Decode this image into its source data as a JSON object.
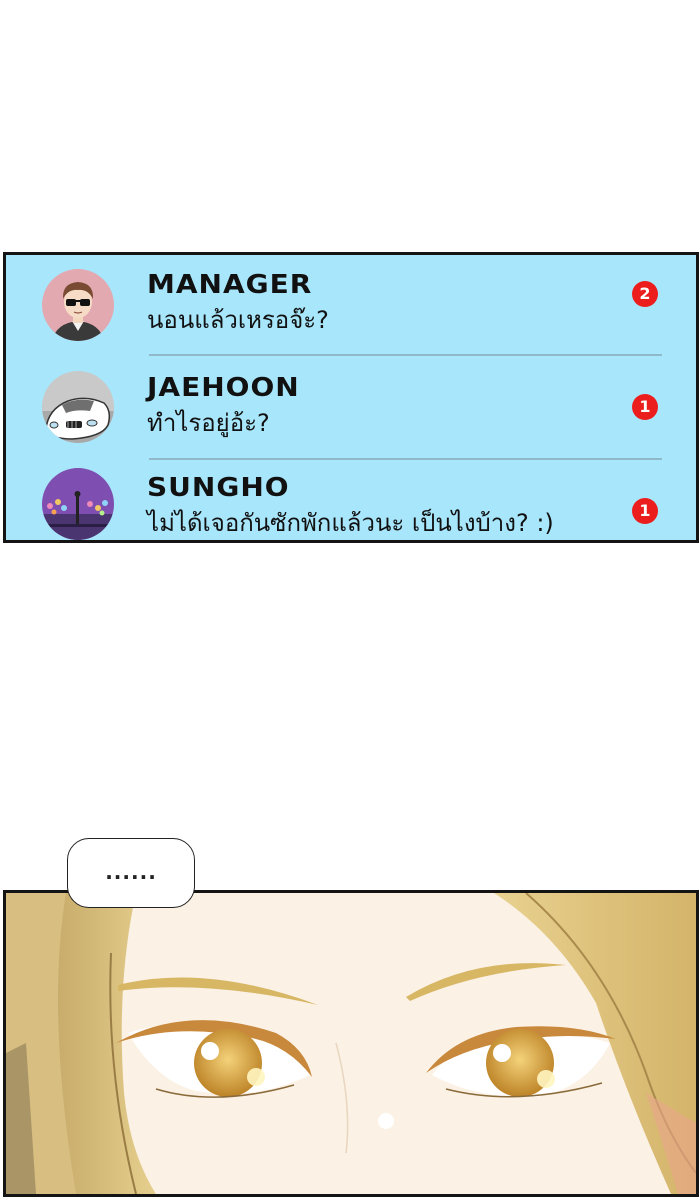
{
  "chat_list": {
    "items": [
      {
        "name": "MANAGER",
        "message": "นอนแล้วเหรอจ๊ะ?",
        "unread": "2",
        "avatar_icon": "man-sunglasses-avatar-icon"
      },
      {
        "name": "JAEHOON",
        "message": "ทำไรอยู่อ้ะ?",
        "unread": "1",
        "avatar_icon": "white-car-avatar-icon"
      },
      {
        "name": "SUNGHO",
        "message": "ไม่ได้เจอกันซักพักแล้วนะ เป็นไงบ้าง? :)",
        "unread": "1",
        "avatar_icon": "night-lights-avatar-icon"
      }
    ],
    "colors": {
      "background": "#a8e6fb",
      "badge": "#ec1d1d",
      "divider": "#8fb8c8"
    }
  },
  "speech_bubble": {
    "text": "......"
  },
  "illustration": {
    "subject": "woman-eyes-closeup-icon",
    "colors": {
      "skin": "#fbf1e4",
      "hair": "#dcc07a",
      "iris": "#c8902a"
    }
  }
}
